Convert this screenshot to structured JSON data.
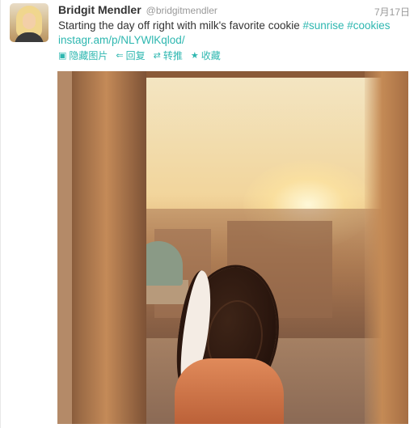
{
  "tweet": {
    "user_name": "Bridgit Mendler",
    "user_handle": "@bridgitmendler",
    "date": "7月17日",
    "text_plain": "Starting the day off right with milk's favorite cookie ",
    "tags": [
      "#sunrise",
      "#cookies"
    ],
    "link": "instagr.am/p/NLYWlKqlod/"
  },
  "actions": [
    {
      "icon": "image-icon",
      "glyph": "▣",
      "label": "隐藏图片"
    },
    {
      "icon": "reply-icon",
      "glyph": "⇐",
      "label": "回复"
    },
    {
      "icon": "retweet-icon",
      "glyph": "⇄",
      "label": "转推"
    },
    {
      "icon": "star-icon",
      "glyph": "★",
      "label": "收藏"
    }
  ],
  "colors": {
    "accent": "#2eb7b0",
    "name": "#333333",
    "muted": "#999999"
  }
}
